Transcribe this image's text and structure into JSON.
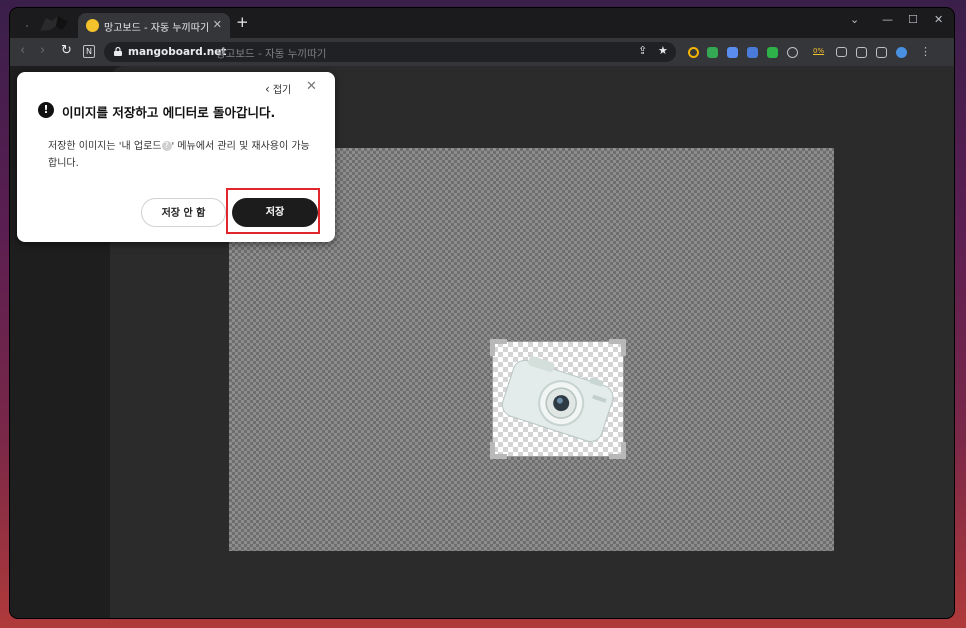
{
  "browser": {
    "tab_title": "망고보드 - 자동 누끼따기",
    "new_tab_symbol": "+",
    "tab_close_symbol": "✕",
    "window_controls": [
      "⌄",
      "—",
      "☐",
      "✕"
    ],
    "url_domain": "mangoboard.net",
    "url_title": "망고보드 - 자동 누끼따기",
    "nav": {
      "back": "‹",
      "forward": "›",
      "reload": "↻",
      "n_badge": "N"
    },
    "omnibox_icons": {
      "share": "⇪",
      "star": "★"
    },
    "ext_label_percent": "0%",
    "colors": {
      "tab_bg": "#35363a",
      "frame_bg": "#1b1b1d",
      "favicon": "#f4c22b"
    }
  },
  "dialog": {
    "collapse_label": "접기",
    "collapse_icon": "chevron-left-icon",
    "close_icon": "close-icon",
    "warning_icon_symbol": "!",
    "title": "이미지를 저장하고 에디터로 돌아갑니다.",
    "message_part1": "저장한 이미지는 '내 업로드",
    "help_icon_symbol": "?",
    "message_part2": "' 메뉴에서 관리 및 재사용이 가능합니다.",
    "no_save_button": "저장 안 함",
    "save_button": "저장",
    "highlight_color": "#e0262b"
  },
  "editor": {
    "canvas_color": "#8d8d8d",
    "product_subject": "camera"
  }
}
